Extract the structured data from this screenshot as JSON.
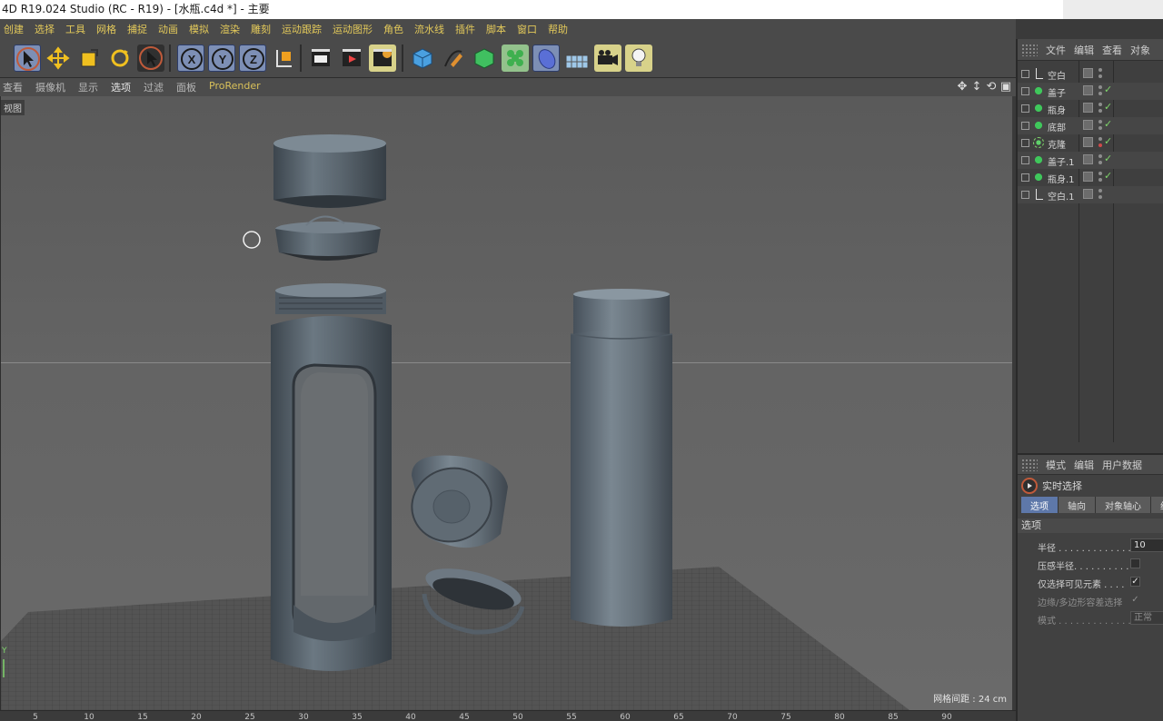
{
  "title": "4D R19.024 Studio (RC - R19) - [水瓶.c4d *] - 主要",
  "menu": [
    "创建",
    "选择",
    "工具",
    "网格",
    "捕捉",
    "动画",
    "模拟",
    "渲染",
    "雕刻",
    "运动跟踪",
    "运动图形",
    "角色",
    "流水线",
    "插件",
    "脚本",
    "窗口",
    "帮助"
  ],
  "toolbar_icons": [
    "select-arrow-icon",
    "move-icon",
    "scale-icon",
    "rotate-icon",
    "live-select-icon",
    "x-axis-icon",
    "y-axis-icon",
    "z-axis-icon",
    "coordinate-system-icon",
    "render-view-icon",
    "render-picture-viewer-icon",
    "render-settings-icon",
    "cube-icon",
    "pen-spline-icon",
    "subdivision-icon",
    "cloner-icon",
    "deformer-icon",
    "floor-icon",
    "camera-icon",
    "light-icon"
  ],
  "viewport_menu": [
    "查看",
    "摄像机",
    "显示",
    "选项",
    "过滤",
    "面板",
    "ProRender"
  ],
  "viewport": {
    "label": "视图",
    "grid_spacing": "网格间距 : 24 cm",
    "axis_label": "Y"
  },
  "timeline_ticks": [
    "5",
    "10",
    "15",
    "20",
    "25",
    "30",
    "35",
    "40",
    "45",
    "50",
    "55",
    "60",
    "65",
    "70",
    "75",
    "80",
    "85",
    "90"
  ],
  "objects_panel": {
    "menu": [
      "文件",
      "编辑",
      "查看",
      "对象"
    ],
    "objects": [
      {
        "name": "空白",
        "icon": "null-icon",
        "checked": false,
        "red": false
      },
      {
        "name": "盖子",
        "icon": "object-icon",
        "checked": true,
        "red": false
      },
      {
        "name": "瓶身",
        "icon": "object-icon",
        "checked": true,
        "red": false
      },
      {
        "name": "底部",
        "icon": "object-icon",
        "checked": true,
        "red": false
      },
      {
        "name": "克隆",
        "icon": "cloner-icon",
        "checked": true,
        "red": true
      },
      {
        "name": "盖子.1",
        "icon": "object-icon",
        "checked": true,
        "red": false
      },
      {
        "name": "瓶身.1",
        "icon": "object-icon",
        "checked": true,
        "red": false
      },
      {
        "name": "空白.1",
        "icon": "null-icon",
        "checked": false,
        "red": false
      }
    ]
  },
  "attributes_panel": {
    "menu": [
      "模式",
      "编辑",
      "用户数据"
    ],
    "tool_name": "实时选择",
    "tabs": [
      "选项",
      "轴向",
      "对象轴心",
      "细"
    ],
    "active_tab": "选项",
    "section_title": "选项",
    "properties": [
      {
        "label": "半径 . . . . . . . . . . . . .",
        "value": "10",
        "type": "number",
        "dim": false
      },
      {
        "label": "压感半径. . . . . . . . . .",
        "value": "",
        "type": "check",
        "dim": false
      },
      {
        "label": "仅选择可见元素 . . . .",
        "value": "✓",
        "type": "check",
        "dim": false
      },
      {
        "label": "边缘/多边形容差选择",
        "value": "✓",
        "type": "check",
        "dim": true
      },
      {
        "label": "模式 . . . . . . . . . . . . .",
        "value": "正常",
        "type": "select",
        "dim": true
      }
    ]
  },
  "colors": {
    "menu_text": "#e3c95a",
    "active_tab": "#5e78a9",
    "model": "#5f6a73"
  }
}
